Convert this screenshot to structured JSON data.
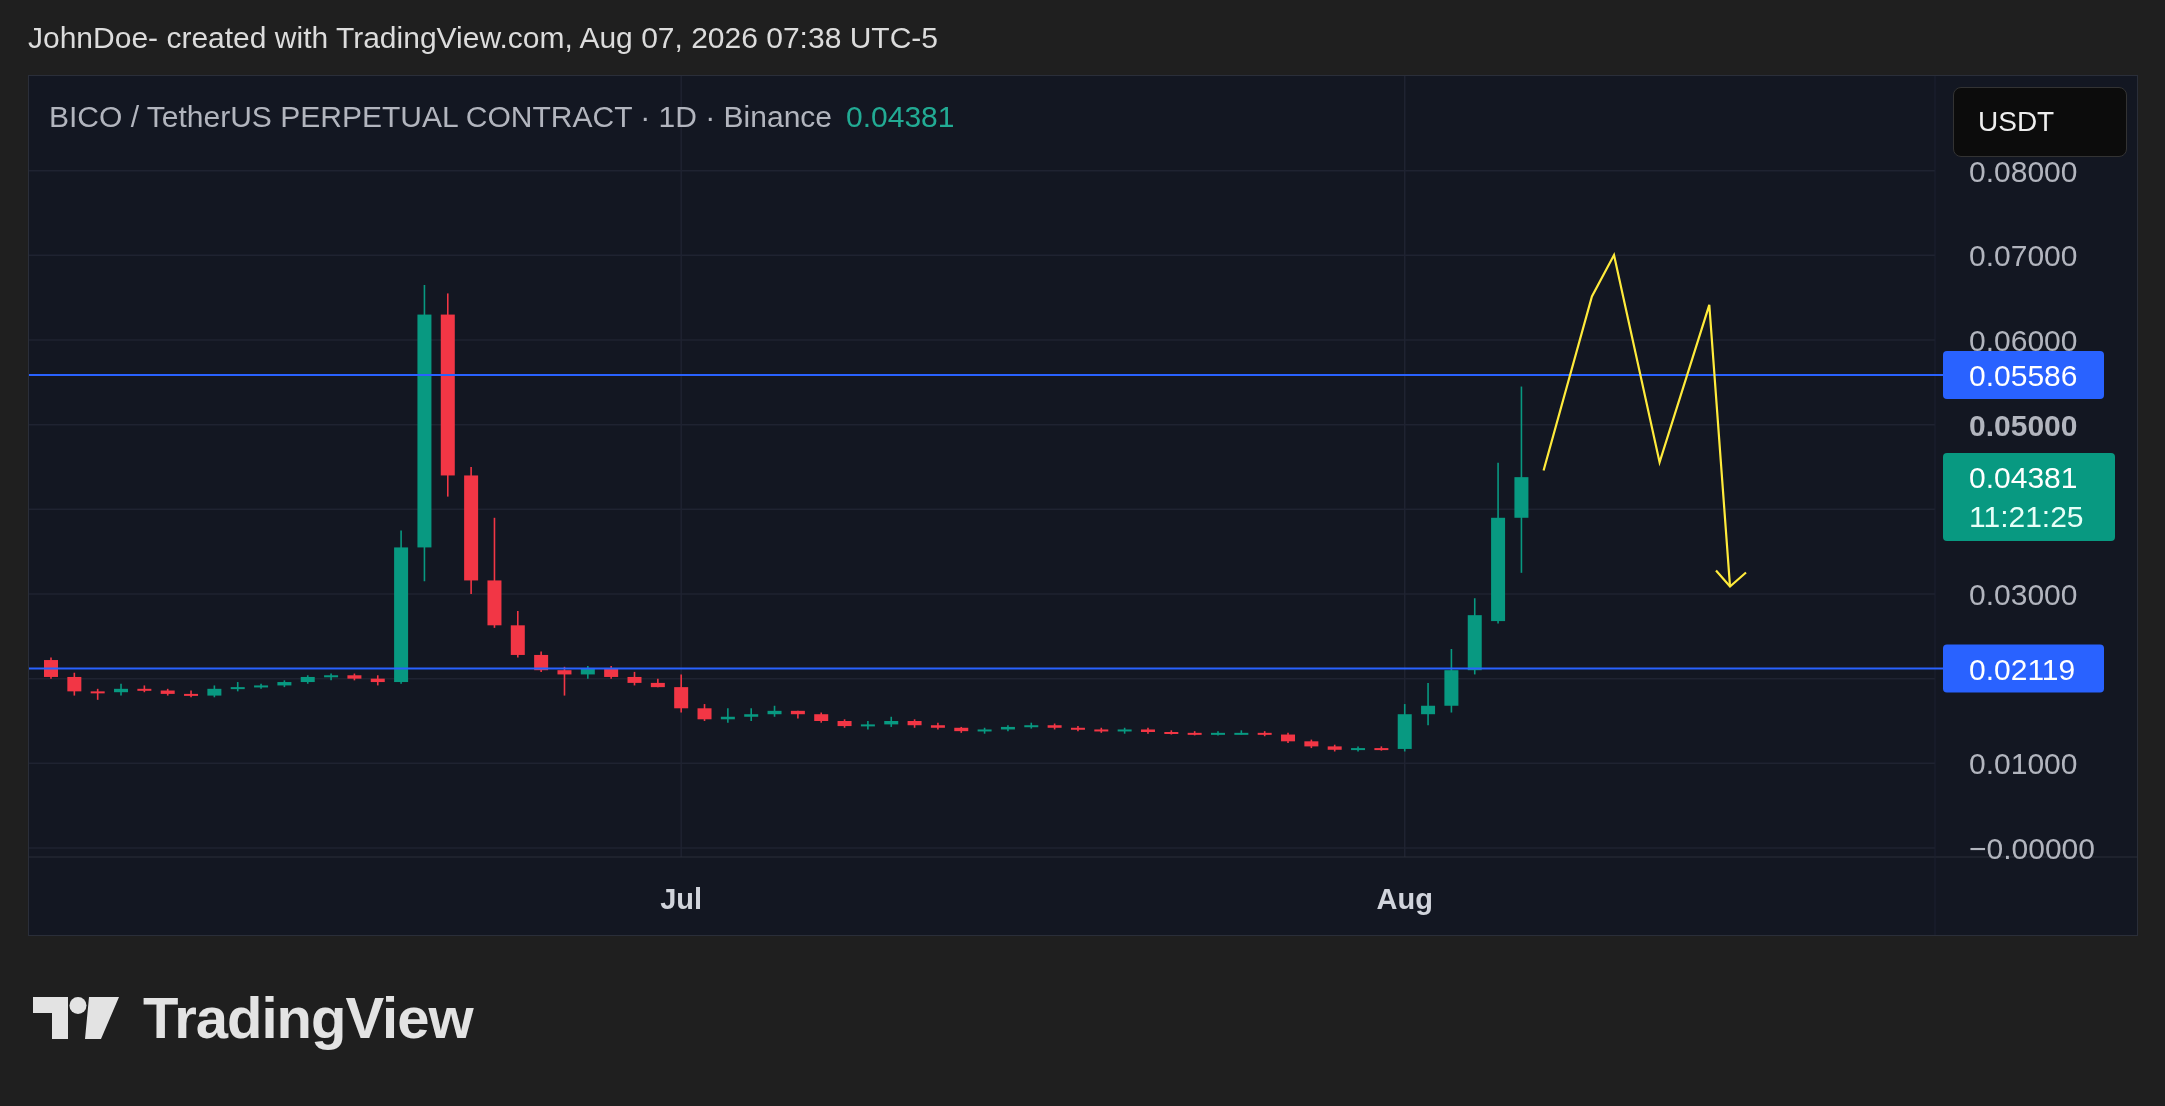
{
  "header": {
    "caption": "JohnDoe- created with TradingView.com, Aug 07, 2026 07:38 UTC-5"
  },
  "chart": {
    "symbol_title": "BICO / TetherUS PERPETUAL CONTRACT · 1D · Binance",
    "last_price": "0.04381",
    "currency_button": "USDT",
    "price_axis": [
      {
        "label": "0.08000",
        "bold": false
      },
      {
        "label": "0.07000",
        "bold": false
      },
      {
        "label": "0.06000",
        "bold": false
      },
      {
        "label": "0.05000",
        "bold": true
      },
      {
        "label": "0.03000",
        "bold": false
      },
      {
        "label": "0.01000",
        "bold": false
      },
      {
        "label": "−0.00000",
        "bold": false
      }
    ],
    "time_axis": [
      "Jul",
      "Aug"
    ],
    "horizontal_lines": [
      {
        "label": "0.05586"
      },
      {
        "label": "0.02119"
      }
    ],
    "price_badge": {
      "price": "0.04381",
      "countdown": "11:21:25"
    }
  },
  "footer": {
    "logo_text": "TradingView"
  }
}
